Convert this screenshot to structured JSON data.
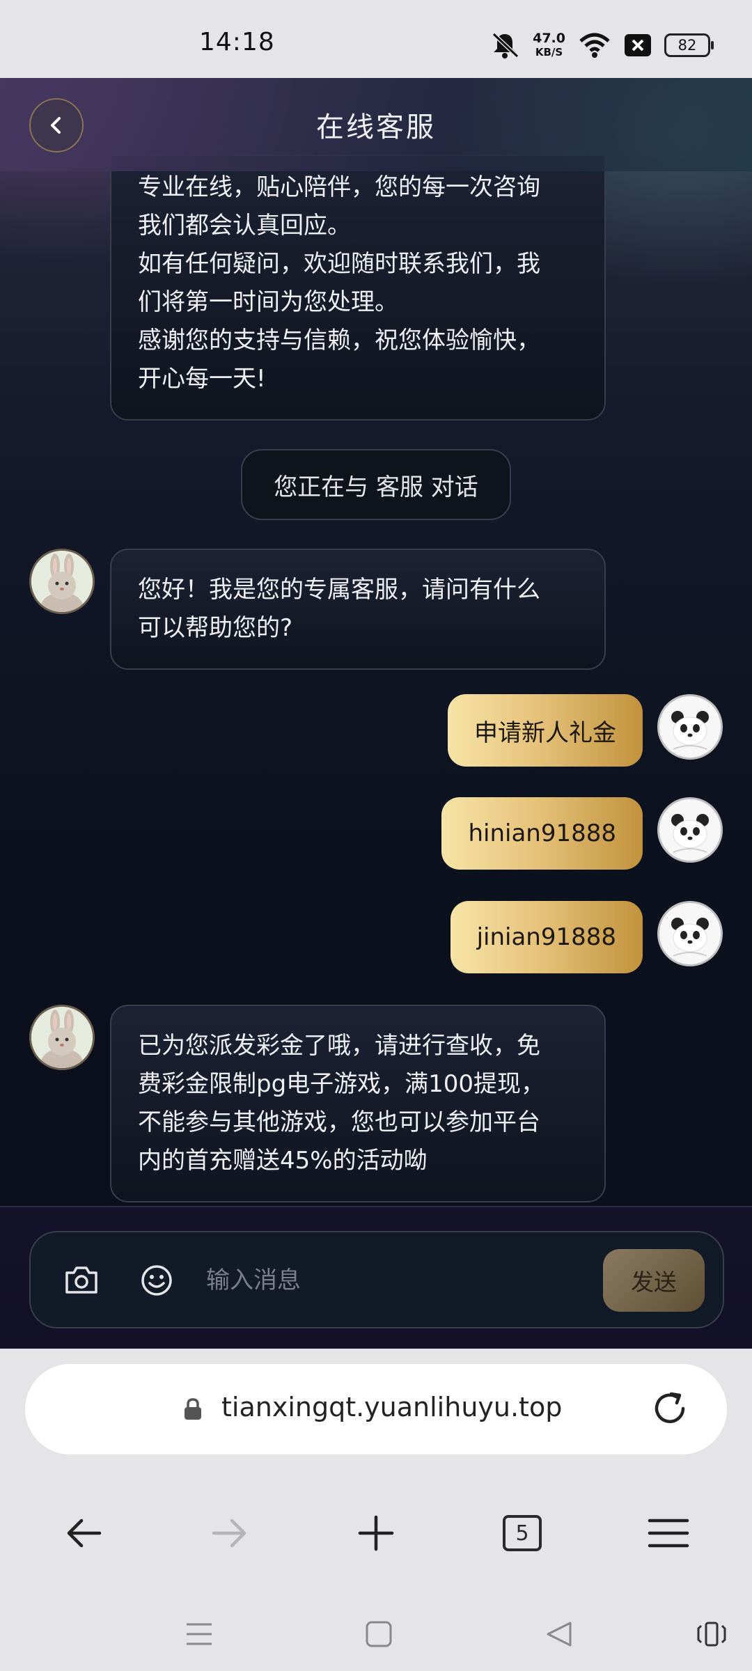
{
  "status_bar": {
    "time": "14:18",
    "net_speed": "47.0",
    "net_unit": "KB/S",
    "battery": "82"
  },
  "header": {
    "title": "在线客服"
  },
  "chat": {
    "intro_lines": [
      "专业在线，贴心陪伴，您的每一次咨询",
      "我们都会认真回应。",
      "如有任何疑问，欢迎随时联系我们，我",
      "们将第一时间为您处理。",
      "感谢您的支持与信赖，祝您体验愉快，",
      "开心每一天!"
    ],
    "notice": "您正在与 客服 对话",
    "agent_greeting_lines": [
      "您好！我是您的专属客服，请问有什么",
      "可以帮助您的?"
    ],
    "user_messages": [
      "申请新人礼金",
      "hinian91888",
      "jinian91888"
    ],
    "agent_reply_lines": [
      "已为您派发彩金了哦，请进行查收，免",
      "费彩金限制pg电子游戏，满100提现，",
      "不能参与其他游戏，您也可以参加平台",
      "内的首充赠送45%的活动呦"
    ]
  },
  "composer": {
    "placeholder": "输入消息",
    "send_label": "发送"
  },
  "browser": {
    "url": "tianxingqt.yuanlihuyu.top",
    "tab_count": "5"
  },
  "colors": {
    "accent_gold": "#c1923d",
    "bubble_dark": "#10141f"
  }
}
